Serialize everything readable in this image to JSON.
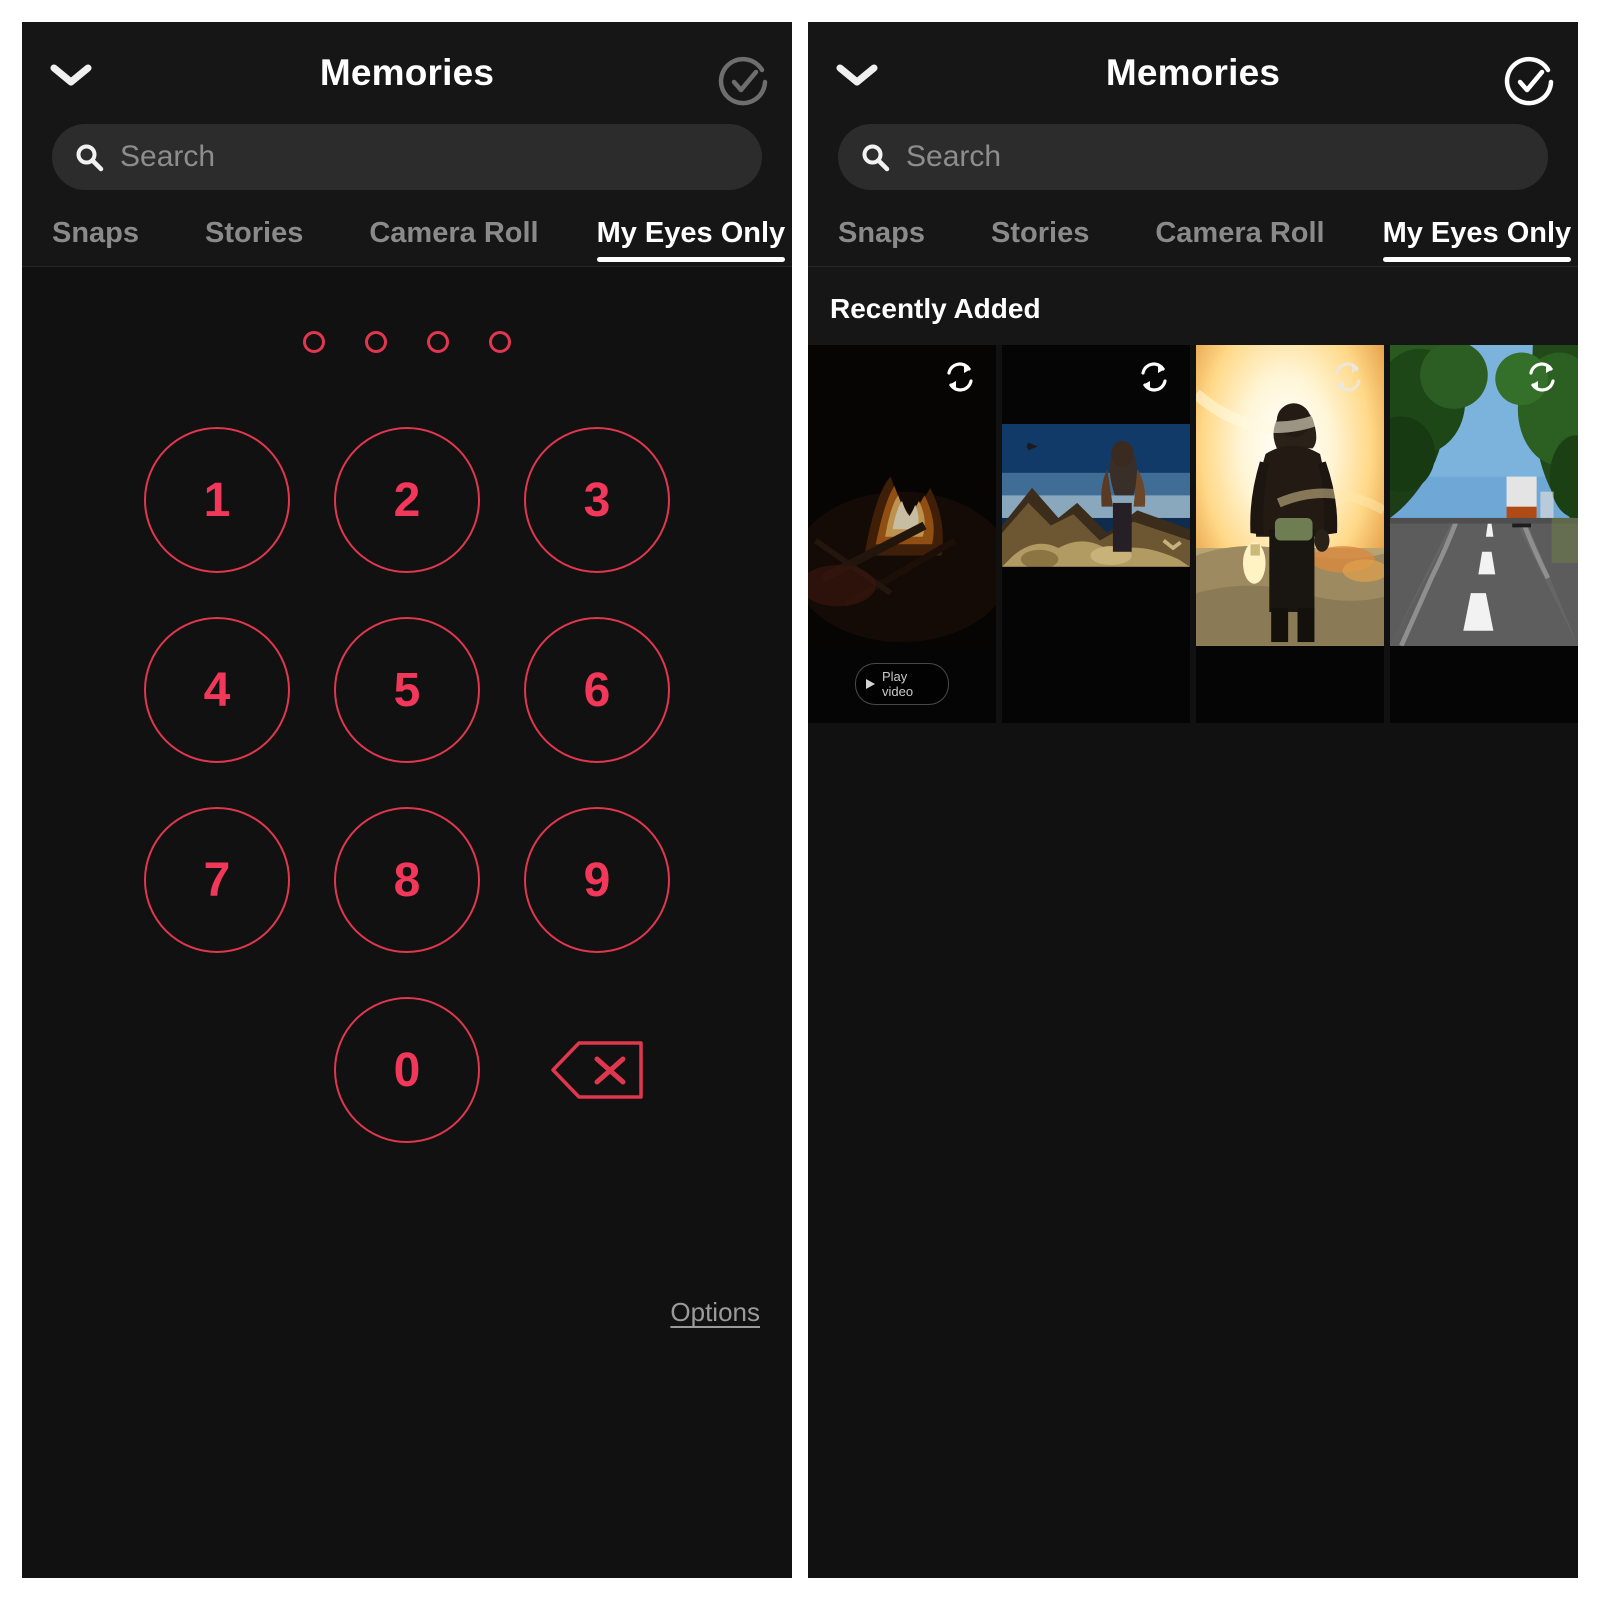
{
  "app": {
    "title": "Memories",
    "accent_pink": "#f1385a",
    "accent_outline": "#e0374f",
    "panel_bg": "#111111",
    "header_bg": "#161616",
    "search_bg": "#2c2c2c",
    "tab_inactive": "#8a8a8a",
    "tab_active": "#ffffff"
  },
  "left_panel": {
    "header": {
      "title": "Memories",
      "back_icon": "chevron-down-icon",
      "confirm_icon": "check-circle-icon"
    },
    "search": {
      "placeholder": "Search",
      "value": "",
      "icon": "search-icon"
    },
    "tabs": [
      {
        "label": "Snaps",
        "active": false
      },
      {
        "label": "Stories",
        "active": false
      },
      {
        "label": "Camera Roll",
        "active": false
      },
      {
        "label": "My Eyes Only",
        "active": true
      }
    ],
    "passcode": {
      "dot_count": 4,
      "dots_filled": 0,
      "keys": [
        "1",
        "2",
        "3",
        "4",
        "5",
        "6",
        "7",
        "8",
        "9",
        "",
        "0",
        "backspace"
      ],
      "backspace_icon": "backspace-delete-icon",
      "options_label": "Options"
    }
  },
  "right_panel": {
    "header": {
      "title": "Memories",
      "back_icon": "chevron-down-icon",
      "confirm_icon": "check-circle-icon"
    },
    "search": {
      "placeholder": "Search",
      "value": "",
      "icon": "search-icon"
    },
    "tabs": [
      {
        "label": "Snaps",
        "active": false
      },
      {
        "label": "Stories",
        "active": false
      },
      {
        "label": "Camera Roll",
        "active": false
      },
      {
        "label": "My Eyes Only",
        "active": true
      }
    ],
    "gallery": {
      "section_label": "Recently Added",
      "items": [
        {
          "description": "campfire at night with burning logs",
          "badge_icon": "sync-icon",
          "play_label": "Play video",
          "has_play_pill": true
        },
        {
          "description": "man standing on rocky mountain summit at dawn",
          "badge_icon": "sync-icon",
          "has_play_pill": false
        },
        {
          "description": "backlit person walking into the sunset holding a bottle",
          "badge_icon": "sync-icon",
          "has_play_pill": false
        },
        {
          "description": "forest road with truck ahead seen from vehicle",
          "badge_icon": "sync-icon",
          "has_play_pill": false
        }
      ]
    }
  }
}
